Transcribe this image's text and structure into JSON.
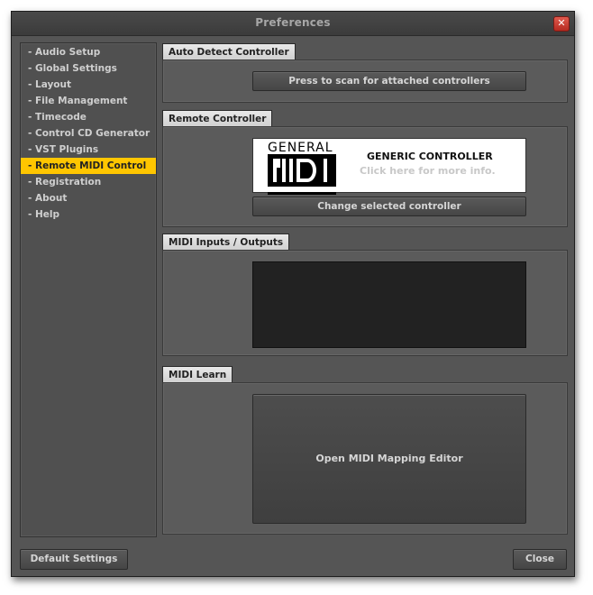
{
  "window": {
    "title": "Preferences",
    "close_glyph": "✕"
  },
  "sidebar": {
    "items": [
      {
        "label": "- Audio Setup"
      },
      {
        "label": "- Global Settings"
      },
      {
        "label": "- Layout"
      },
      {
        "label": "- File Management"
      },
      {
        "label": "- Timecode"
      },
      {
        "label": "- Control CD Generator"
      },
      {
        "label": "- VST Plugins"
      },
      {
        "label": "- Remote MIDI Control",
        "active": true
      },
      {
        "label": "- Registration"
      },
      {
        "label": "- About"
      },
      {
        "label": "- Help"
      }
    ]
  },
  "auto_detect": {
    "tab_label": "Auto Detect Controller",
    "scan_button": "Press to scan for attached controllers"
  },
  "remote_controller": {
    "tab_label": "Remote Controller",
    "logo_top": "GENERAL",
    "logo_bottom": "MIDI",
    "controller_name": "GENERIC CONTROLLER",
    "hint": "Click here for more info.",
    "change_button": "Change selected controller"
  },
  "midi_io": {
    "tab_label": "MIDI Inputs / Outputs"
  },
  "midi_learn": {
    "tab_label": "MIDI Learn",
    "open_button": "Open MIDI Mapping Editor"
  },
  "footer": {
    "default_button": "Default Settings",
    "close_button": "Close"
  },
  "colors": {
    "accent": "#ffc600",
    "window_bg": "#555555",
    "close_red": "#c9372c"
  }
}
